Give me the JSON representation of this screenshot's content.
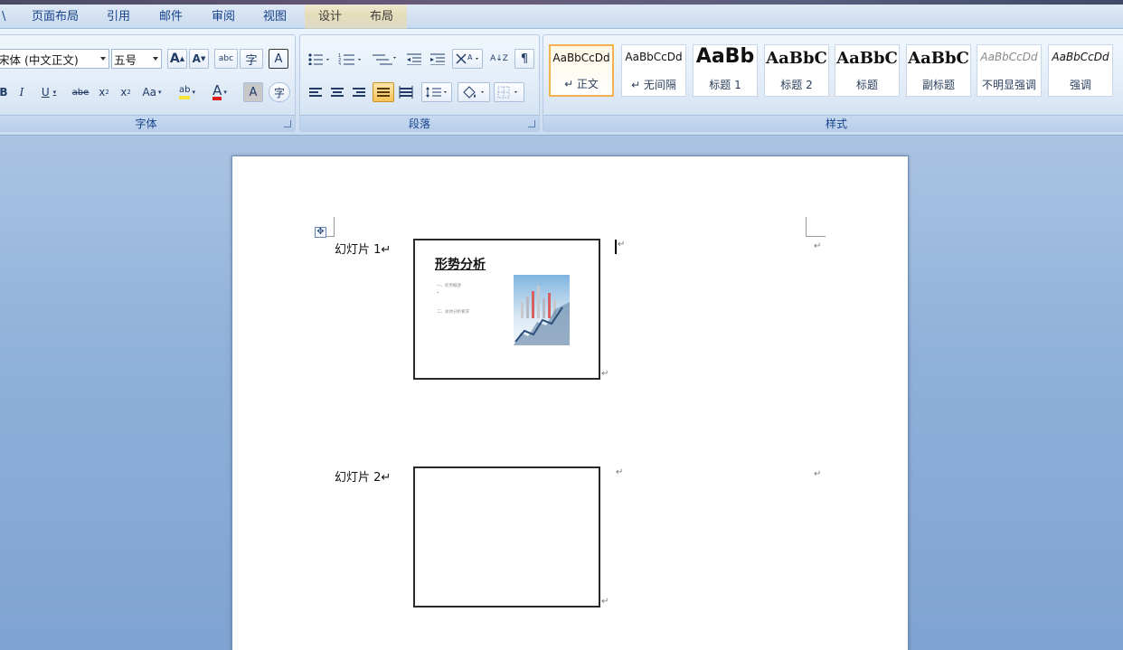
{
  "tabs": {
    "t0": "\\",
    "t1": "页面布局",
    "t2": "引用",
    "t3": "邮件",
    "t4": "审阅",
    "t5": "视图",
    "t6": "设计",
    "t7": "布局"
  },
  "font_group": {
    "label": "字体",
    "font_name": "宋体 (中文正文)",
    "font_size": "五号",
    "grow_font": "A",
    "shrink_font": "A",
    "phonetic": "abc",
    "enclose": "字",
    "char_border": "A",
    "bold": "B",
    "italic": "I",
    "underline": "U",
    "strikethrough": "abe",
    "subscript": "x",
    "superscript": "x",
    "change_case": "Aa",
    "highlight": "ab",
    "font_color": "A",
    "char_shading": "A",
    "enclose_char": "字"
  },
  "paragraph_group": {
    "label": "段落",
    "sort_label": "A↓Z"
  },
  "styles_group": {
    "label": "样式",
    "items": [
      {
        "sample": "AaBbCcDd",
        "name": "↵ 正文"
      },
      {
        "sample": "AaBbCcDd",
        "name": "↵ 无间隔"
      },
      {
        "sample": "AaBb",
        "name": "标题 1"
      },
      {
        "sample": "AaBbC",
        "name": "标题 2"
      },
      {
        "sample": "AaBbC",
        "name": "标题"
      },
      {
        "sample": "AaBbC",
        "name": "副标题"
      },
      {
        "sample": "AaBbCcDd",
        "name": "不明显强调"
      },
      {
        "sample": "AaBbCcDd",
        "name": "强调"
      }
    ]
  },
  "document": {
    "slide1_label": "幻灯片 1↵",
    "slide2_label": "幻灯片 2↵",
    "para_mark": "↵",
    "slide1_title": "形势分析",
    "slide1_lines": [
      "一、形势概述",
      "•",
      "二、总体分析要求"
    ]
  },
  "colors": {
    "accent": "#15428b",
    "selected_style_border": "#f2b24f",
    "highlight_yellow": "#f5e23a",
    "font_red": "#e0201c"
  }
}
